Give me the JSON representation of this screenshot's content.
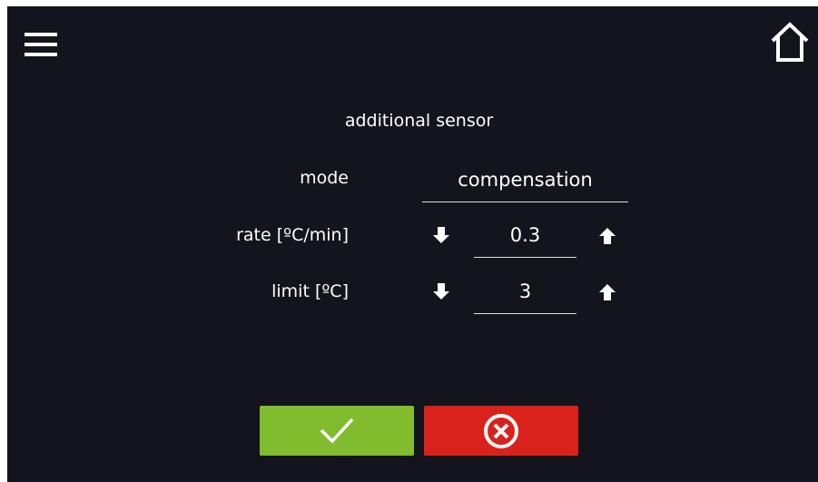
{
  "screen": {
    "title": "additional sensor"
  },
  "rows": {
    "mode": {
      "label": "mode",
      "value": "compensation"
    },
    "rate": {
      "label": "rate [ºC/min]",
      "value": "0.3"
    },
    "limit": {
      "label": "limit [ºC]",
      "value": "3"
    }
  },
  "icons": {
    "menu": "hamburger-menu-icon",
    "home": "home-icon",
    "decrease": "arrow-down-icon",
    "increase": "arrow-up-icon",
    "confirm": "checkmark-icon",
    "cancel": "circled-x-icon"
  },
  "colors": {
    "background": "#14141c",
    "confirm_button": "#80bc2e",
    "cancel_button": "#d9221c"
  }
}
